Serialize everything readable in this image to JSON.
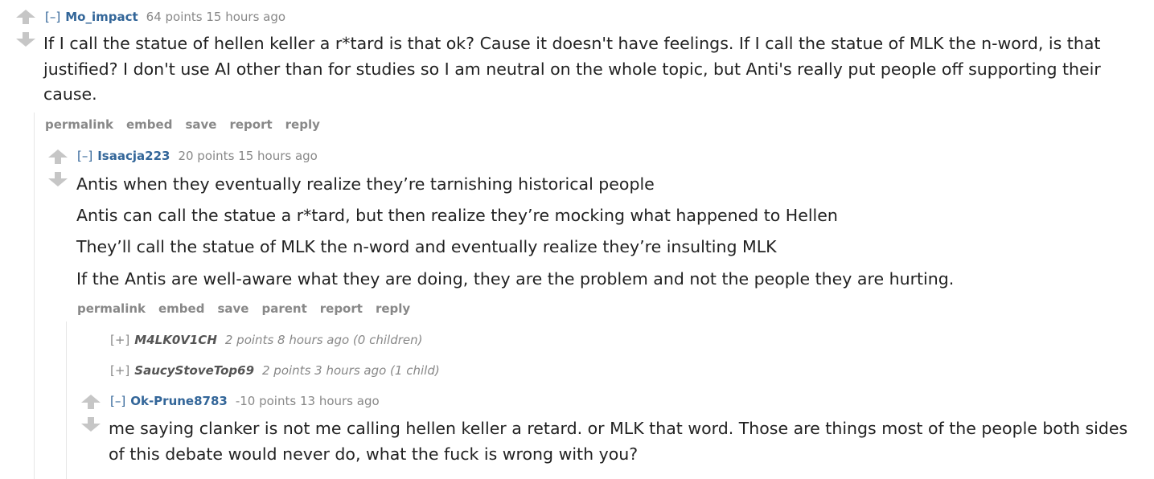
{
  "comments": [
    {
      "toggle": "[–]",
      "author": "Mo_impact",
      "score": "64 points",
      "time": "15 hours ago",
      "body": "If I call the statue of hellen keller a r*tard is that ok? Cause it doesn't have feelings. If I call the statue of MLK the n-word, is that justified? I don't use AI other than for studies so I am neutral on the whole topic, but Anti's really put people off supporting their cause.",
      "buttons": [
        "permalink",
        "embed",
        "save",
        "report",
        "reply"
      ]
    },
    {
      "toggle": "[–]",
      "author": "Isaacja223",
      "score": "20 points",
      "time": "15 hours ago",
      "paragraphs": [
        "Antis when they eventually realize they’re tarnishing historical people",
        "Antis can call the statue a r*tard, but then realize they’re mocking what happened to Hellen",
        "They’ll call the statue of MLK the n-word and eventually realize they’re insulting MLK",
        "If the Antis are well-aware what they are doing, they are the problem and not the people they are hurting."
      ],
      "buttons": [
        "permalink",
        "embed",
        "save",
        "parent",
        "report",
        "reply"
      ]
    },
    {
      "toggle": "[–]",
      "author": "Ok-Prune8783",
      "score": "-10 points",
      "time": "13 hours ago",
      "body": "me saying clanker is not me calling hellen keller a retard. or MLK that word. Those are things most of the people both sides of this debate would never do, what the fuck is wrong with you?"
    }
  ],
  "collapsed": [
    {
      "toggle": "[+]",
      "author": "M4LK0V1CH",
      "meta": "2 points 8 hours ago (0 children)"
    },
    {
      "toggle": "[+]",
      "author": "SaucyStoveTop69",
      "meta": "2 points 3 hours ago (1 child)"
    }
  ],
  "colors": {
    "link": "#336699",
    "muted": "#888888",
    "text": "#222222",
    "arrow": "#c6c6c6"
  }
}
